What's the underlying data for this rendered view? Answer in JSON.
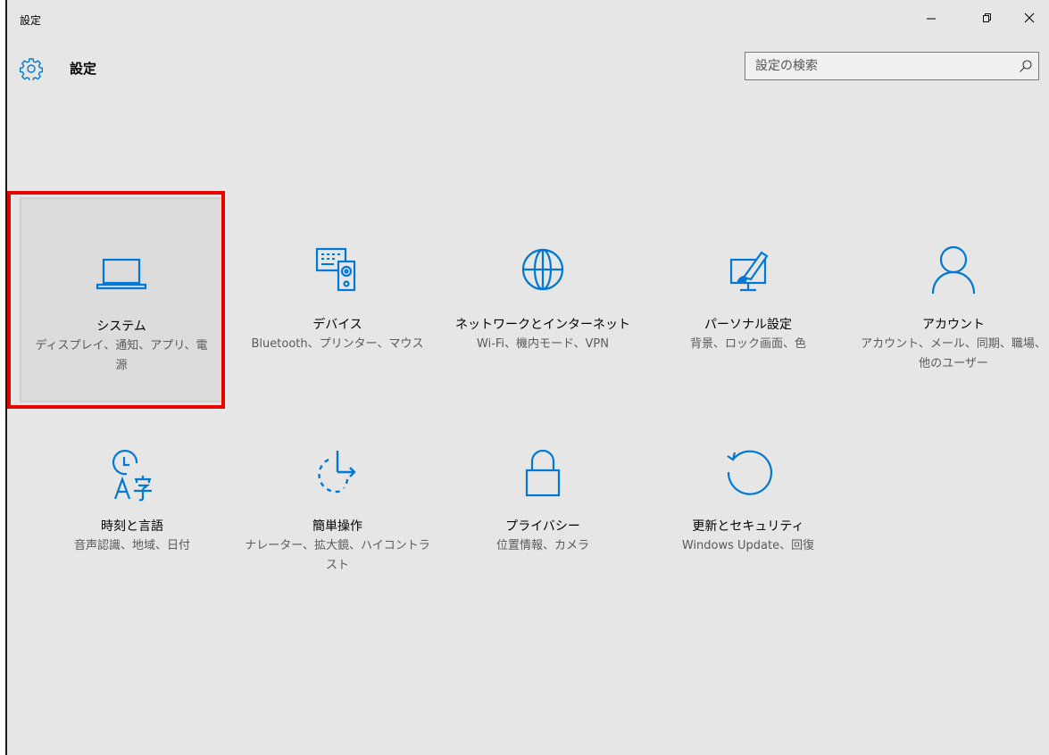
{
  "window": {
    "title": "設定"
  },
  "header": {
    "title": "設定",
    "icon": "gear-icon"
  },
  "search": {
    "placeholder": "設定の検索",
    "icon": "search-icon"
  },
  "accent_color": "#0078d7",
  "highlight_color": "#e60000",
  "tiles": [
    {
      "label": "システム",
      "desc": "ディスプレイ、通知、アプリ、電源",
      "icon": "laptop-icon"
    },
    {
      "label": "デバイス",
      "desc": "Bluetooth、プリンター、マウス",
      "icon": "devices-icon"
    },
    {
      "label": "ネットワークとインターネット",
      "desc": "Wi-Fi、機内モード、VPN",
      "icon": "globe-icon"
    },
    {
      "label": "パーソナル設定",
      "desc": "背景、ロック画面、色",
      "icon": "personalization-icon"
    },
    {
      "label": "アカウント",
      "desc": "アカウント、メール、同期、職場、他のユーザー",
      "icon": "person-icon"
    },
    {
      "label": "時刻と言語",
      "desc": "音声認識、地域、日付",
      "icon": "time-language-icon"
    },
    {
      "label": "簡単操作",
      "desc": "ナレーター、拡大鏡、ハイコントラスト",
      "icon": "ease-of-access-icon"
    },
    {
      "label": "プライバシー",
      "desc": "位置情報、カメラ",
      "icon": "lock-icon"
    },
    {
      "label": "更新とセキュリティ",
      "desc": "Windows Update、回復",
      "icon": "update-icon"
    }
  ]
}
